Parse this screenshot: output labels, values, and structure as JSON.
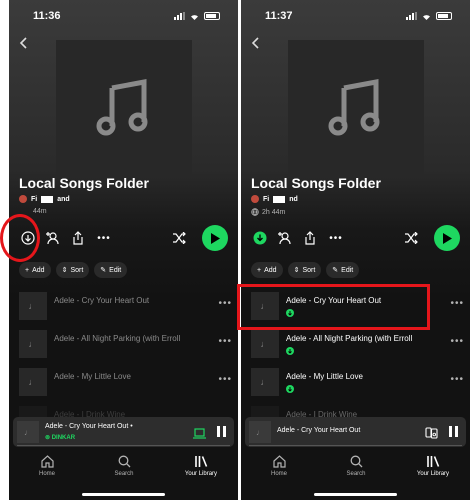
{
  "left": {
    "status": {
      "time": "11:36"
    },
    "playlist": {
      "title": "Local Songs Folder",
      "owner_visible": "Fi",
      "owner_visible_end": "and",
      "duration": "44m"
    },
    "chips": {
      "add": "Add",
      "sort": "Sort",
      "edit": "Edit"
    },
    "tracks": [
      "Adele - Cry Your Heart Out",
      "Adele - All Night Parking (with Erroll",
      "Adele - My Little Love",
      "Adele - I Drink Wine"
    ],
    "mini_player": {
      "title": "Adele - Cry Your Heart Out •",
      "device": "DINKAR"
    },
    "tabs": {
      "home": "Home",
      "search": "Search",
      "library": "Your Library"
    }
  },
  "right": {
    "status": {
      "time": "11:37"
    },
    "playlist": {
      "title": "Local Songs Folder",
      "owner_visible": "Fi",
      "owner_visible_end": "nd",
      "duration": "2h 44m"
    },
    "chips": {
      "add": "Add",
      "sort": "Sort",
      "edit": "Edit"
    },
    "tracks": [
      "Adele - Cry Your Heart Out",
      "Adele - All Night Parking (with Erroll",
      "Adele - My Little Love",
      "Adele - I Drink Wine"
    ],
    "mini_player": {
      "title": "Adele - Cry Your Heart Out"
    },
    "tabs": {
      "home": "Home",
      "search": "Search",
      "library": "Your Library"
    }
  },
  "colors": {
    "accent": "#1ed760",
    "annotation": "#e5161b",
    "background": "#121212"
  },
  "icons": [
    "music-note-icon",
    "download-icon",
    "add-person-icon",
    "share-icon",
    "more-icon",
    "shuffle-icon",
    "play-icon",
    "pause-icon",
    "connect-device-icon",
    "home-icon",
    "search-icon",
    "library-icon",
    "globe-icon",
    "downloaded-icon"
  ]
}
